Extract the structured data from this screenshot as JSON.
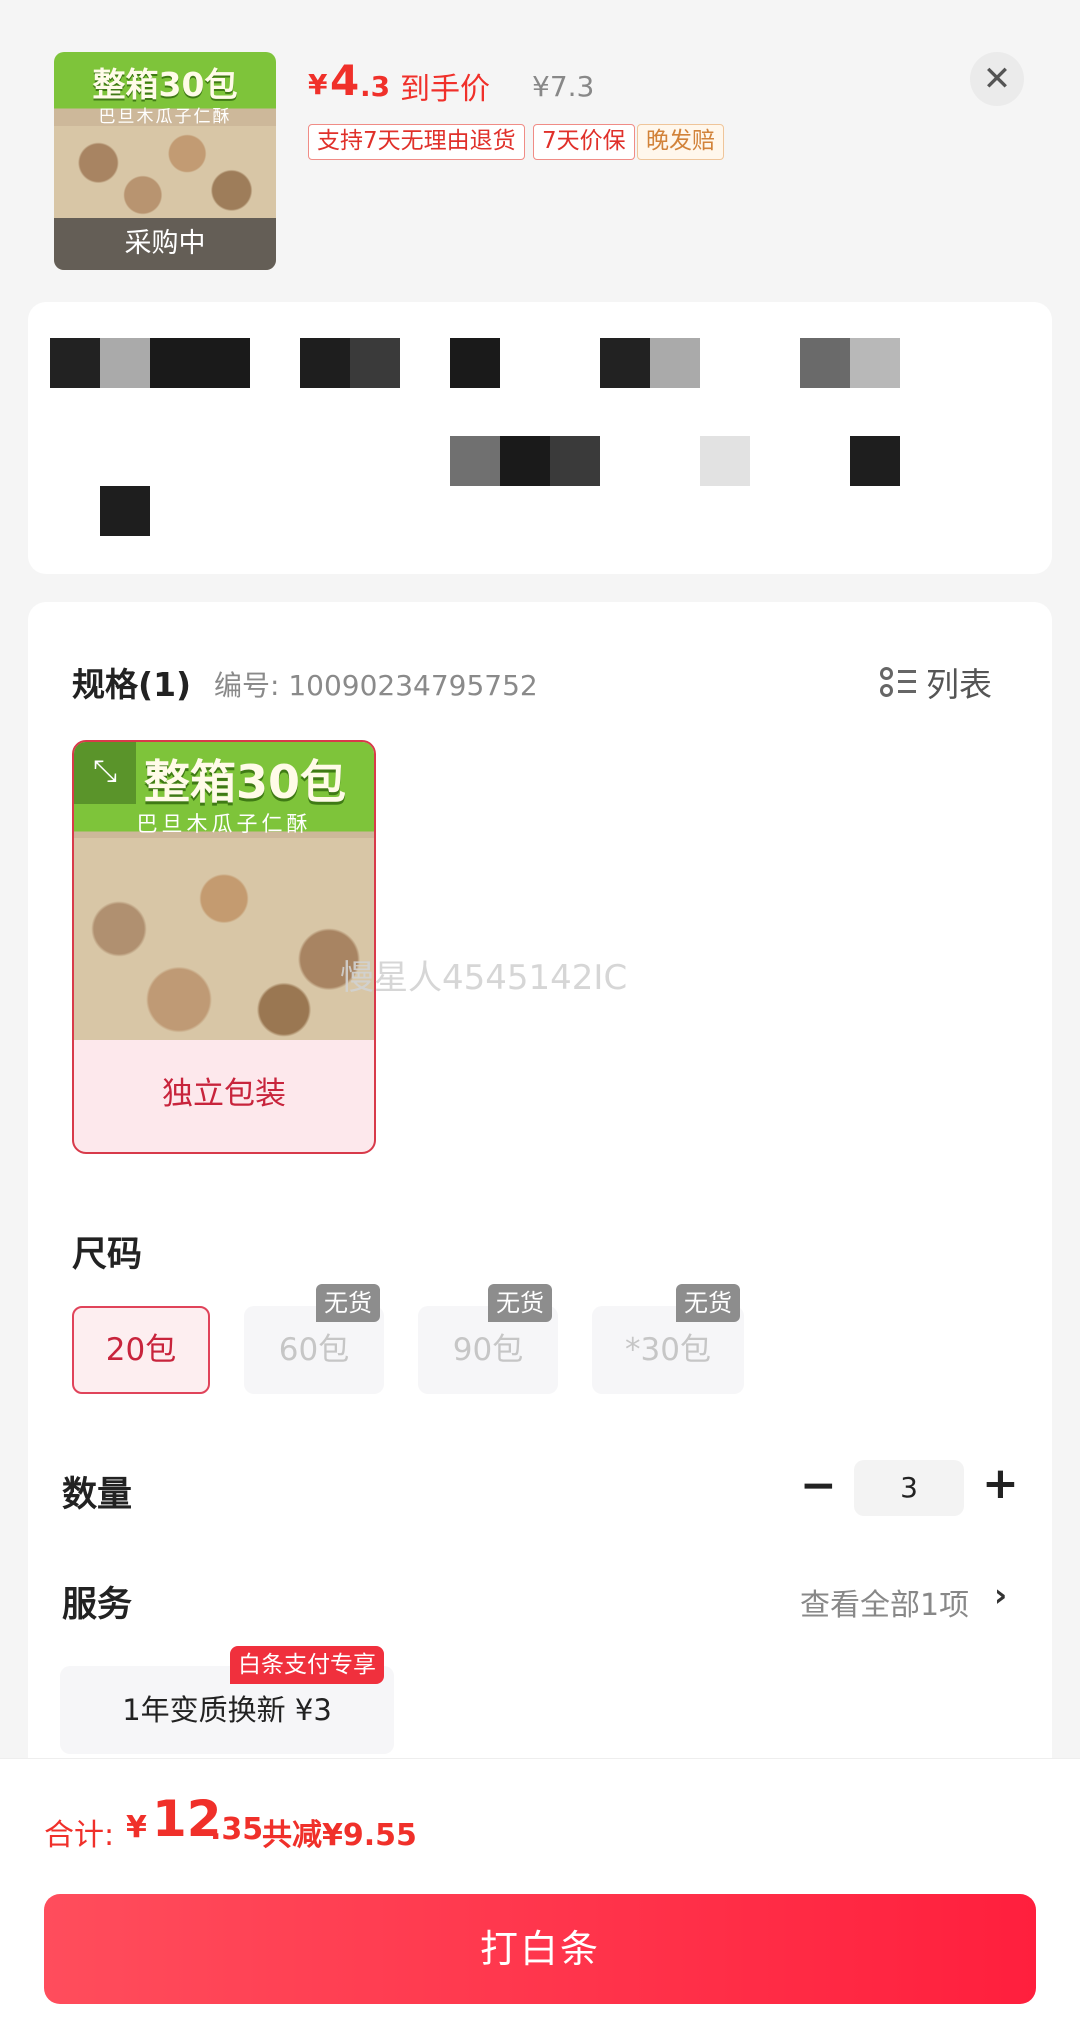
{
  "product": {
    "thumb_title": "整箱30包",
    "thumb_subtitle": "巴旦木瓜子仁酥",
    "thumb_status": "采购中",
    "price_currency": "¥",
    "price_integer": "4",
    "price_decimal": ".3",
    "price_label": "到手价",
    "original_price": "¥7.3",
    "tags": [
      "支持7天无理由退货",
      "7天价保",
      "晚发赔"
    ]
  },
  "spec": {
    "title": "规格(1)",
    "number": "编号: 10090234795752",
    "list_toggle_label": "列表",
    "option_label": "独立包装",
    "watermark": "慢星人4545142IC"
  },
  "size": {
    "title": "尺码",
    "options": [
      "20包",
      "60包",
      "90包",
      "*30包"
    ],
    "out_of_stock_label": "无货"
  },
  "quantity": {
    "title": "数量",
    "minus": "−",
    "value": "3",
    "plus": "+"
  },
  "service": {
    "title": "服务",
    "view_all": "查看全部1项",
    "chevron": "›",
    "chip": "1年变质换新  ¥3",
    "badge": "白条支付专享"
  },
  "footer": {
    "total_label": "合计:",
    "total_currency": "¥",
    "total_integer": "12",
    "total_decimal": ".35",
    "discount": "共减¥9.55",
    "pay_button": "打白条"
  },
  "colors": {
    "accent": "#f0302a",
    "pay_button_start": "#ff4d5c",
    "pay_button_end": "#ff1f3d",
    "selected_border": "#e0435a"
  },
  "icons": {
    "close": "close-icon",
    "list": "list-view-icon",
    "expand": "expand-icon",
    "chevron": "chevron-right-icon"
  }
}
